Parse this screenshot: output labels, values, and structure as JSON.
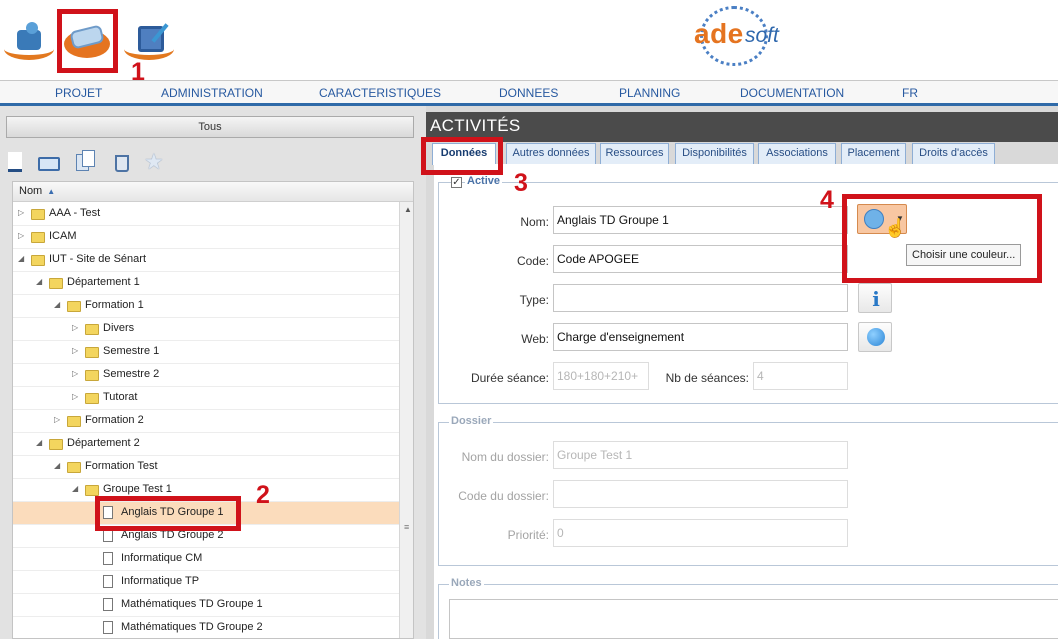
{
  "header": {
    "logo_ade": "ade",
    "logo_soft": "soft",
    "icons": [
      "admin-user-icon",
      "data-stack-icon",
      "calendar-planning-icon"
    ]
  },
  "annotations": [
    "1",
    "2",
    "3",
    "4"
  ],
  "menu": [
    "PROJET",
    "ADMINISTRATION",
    "CARACTERISTIQUES",
    "DONNEES",
    "PLANNING",
    "DOCUMENTATION",
    "FR"
  ],
  "left": {
    "filter_button": "Tous",
    "toolbar": [
      "new-document-icon",
      "folder-icon",
      "copy-icon",
      "trash-icon",
      "star-icon"
    ],
    "column_header": "Nom",
    "sort_indicator": "▲",
    "tree": [
      {
        "label": "AAA - Test",
        "type": "folder",
        "depth": 0,
        "state": "collapsed"
      },
      {
        "label": "ICAM",
        "type": "folder",
        "depth": 0,
        "state": "collapsed"
      },
      {
        "label": "IUT - Site de Sénart",
        "type": "folder",
        "depth": 0,
        "state": "expanded"
      },
      {
        "label": "Département 1",
        "type": "folder",
        "depth": 1,
        "state": "expanded"
      },
      {
        "label": "Formation 1",
        "type": "folder",
        "depth": 2,
        "state": "expanded"
      },
      {
        "label": "Divers",
        "type": "folder",
        "depth": 3,
        "state": "collapsed"
      },
      {
        "label": "Semestre 1",
        "type": "folder",
        "depth": 3,
        "state": "collapsed"
      },
      {
        "label": "Semestre 2",
        "type": "folder",
        "depth": 3,
        "state": "collapsed"
      },
      {
        "label": "Tutorat",
        "type": "folder",
        "depth": 3,
        "state": "collapsed"
      },
      {
        "label": "Formation 2",
        "type": "folder",
        "depth": 2,
        "state": "collapsed"
      },
      {
        "label": "Département 2",
        "type": "folder",
        "depth": 1,
        "state": "expanded"
      },
      {
        "label": "Formation Test",
        "type": "folder",
        "depth": 2,
        "state": "expanded"
      },
      {
        "label": "Groupe Test 1",
        "type": "folder",
        "depth": 3,
        "state": "expanded"
      },
      {
        "label": "Anglais TD Groupe 1",
        "type": "doc",
        "depth": 4,
        "selected": true
      },
      {
        "label": "Anglais TD Groupe 2",
        "type": "doc",
        "depth": 4
      },
      {
        "label": "Informatique CM",
        "type": "doc",
        "depth": 4
      },
      {
        "label": "Informatique TP",
        "type": "doc",
        "depth": 4
      },
      {
        "label": "Mathématiques TD Groupe 1",
        "type": "doc",
        "depth": 4
      },
      {
        "label": "Mathématiques TD Groupe 2",
        "type": "doc",
        "depth": 4
      }
    ]
  },
  "right": {
    "title": "ACTIVITÉS",
    "tabs": [
      "Données",
      "Autres données",
      "Ressources",
      "Disponibilités",
      "Associations",
      "Placement",
      "Droits d'accès"
    ],
    "active_tab": "Données",
    "active_section": {
      "legend": "Active",
      "checked": "✓",
      "nom_label": "Nom:",
      "nom_value": "Anglais TD Groupe 1",
      "code_label": "Code:",
      "code_value": "Code APOGEE",
      "type_label": "Type:",
      "type_value": "",
      "web_label": "Web:",
      "web_value": "Charge d'enseignement",
      "duree_label": "Durée séance:",
      "duree_value": "180+180+210+",
      "nb_label": "Nb de séances:",
      "nb_value": "4",
      "color_tooltip": "Choisir une couleur..."
    },
    "dossier": {
      "legend": "Dossier",
      "nom_label": "Nom du dossier:",
      "nom_value": "Groupe Test 1",
      "code_label": "Code du dossier:",
      "code_value": "",
      "priorite_label": "Priorité:",
      "priorite_value": "0"
    },
    "notes": {
      "legend": "Notes"
    }
  },
  "colors": {
    "accent_orange": "#e57420",
    "accent_blue": "#2f68ad",
    "annotation_red": "#d0121a",
    "selection": "#fbdcbc"
  }
}
